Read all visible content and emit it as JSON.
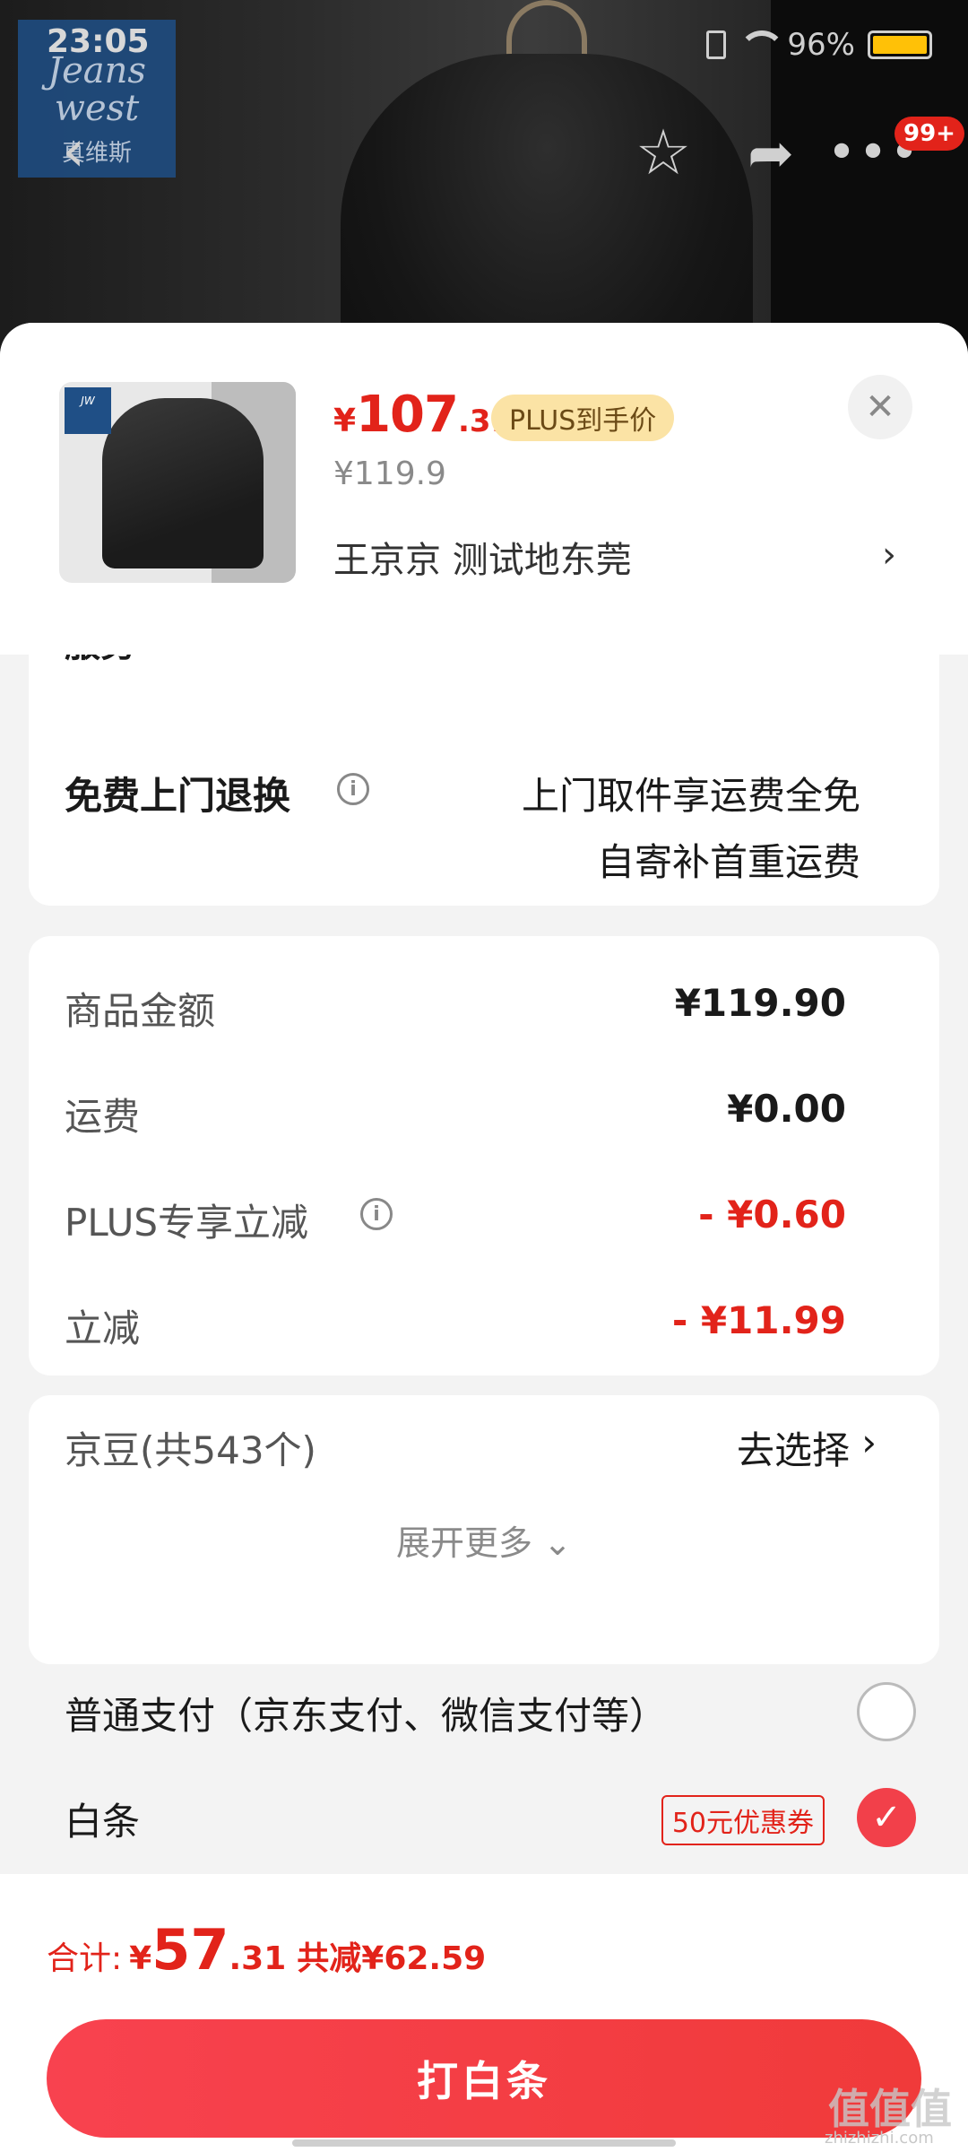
{
  "status_bar": {
    "time": "23:05",
    "battery": "96%"
  },
  "brand": {
    "line1": "Jeans",
    "line2": "west",
    "line3": "真维斯"
  },
  "nav": {
    "badge": "99+"
  },
  "product": {
    "price_yen": "¥",
    "price_int": "107",
    "price_dec": ".31",
    "plus_tag": "PLUS到手价",
    "original_price": "¥119.9",
    "address": "王京京  测试地东莞"
  },
  "service": {
    "top_label": "服务",
    "label": "免费上门退换",
    "line1": "上门取件享运费全免",
    "line2": "自寄补首重运费"
  },
  "summary": {
    "rows": [
      {
        "label": "商品金额",
        "value": "¥119.90"
      },
      {
        "label": "运费",
        "value": "¥0.00"
      },
      {
        "label": "PLUS专享立减",
        "value": "- ¥0.60"
      },
      {
        "label": "立减",
        "value": "- ¥11.99"
      },
      {
        "label": "京豆(共543个)",
        "value": "去选择"
      }
    ],
    "expand": "展开更多 ⌄"
  },
  "payment": {
    "option1": "普通支付（京东支付、微信支付等）",
    "option2": "白条",
    "coupon": "50元优惠券"
  },
  "footer": {
    "total_label": "合计:",
    "total_yen": "¥",
    "total_int": "57",
    "total_dec": ".31",
    "total_saved": "共减¥62.59",
    "pay_button": "打白条"
  },
  "watermark": {
    "main": "值值值",
    "sub": "zhizhizhi.com"
  },
  "colors": {
    "accent": "#e2231a",
    "plus_tag_bg": "#fbe3a5",
    "button": "#f03a3a"
  }
}
